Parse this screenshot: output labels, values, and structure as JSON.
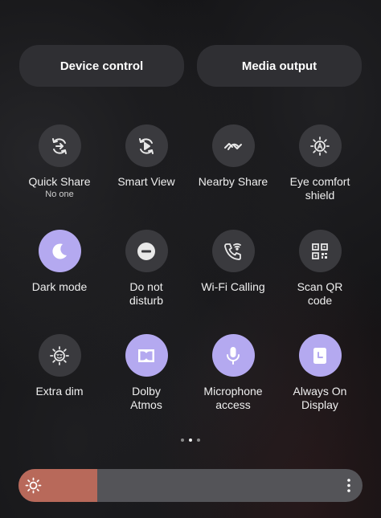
{
  "top_buttons": {
    "device_control": "Device control",
    "media_output": "Media output"
  },
  "tiles": [
    {
      "label": "Quick Share",
      "sub": "No one",
      "icon": "quick-share-icon",
      "on": false
    },
    {
      "label": "Smart View",
      "icon": "smart-view-icon",
      "on": false
    },
    {
      "label": "Nearby Share",
      "icon": "nearby-share-icon",
      "on": false
    },
    {
      "label": "Eye comfort\nshield",
      "icon": "eye-comfort-icon",
      "on": false
    },
    {
      "label": "Dark mode",
      "icon": "moon-icon",
      "on": true
    },
    {
      "label": "Do not\ndisturb",
      "icon": "do-not-disturb-icon",
      "on": false
    },
    {
      "label": "Wi-Fi Calling",
      "icon": "wifi-calling-icon",
      "on": false
    },
    {
      "label": "Scan QR\ncode",
      "icon": "qr-code-icon",
      "on": false
    },
    {
      "label": "Extra dim",
      "icon": "extra-dim-icon",
      "on": false
    },
    {
      "label": "Dolby\nAtmos",
      "icon": "dolby-icon",
      "on": true
    },
    {
      "label": "Microphone\naccess",
      "icon": "microphone-icon",
      "on": true
    },
    {
      "label": "Always On\nDisplay",
      "icon": "clock-icon",
      "on": true
    }
  ],
  "pager": {
    "count": 3,
    "active": 1
  },
  "brightness": {
    "level": 0.23,
    "icon": "sun-icon",
    "menu_icon": "more-vertical-icon"
  },
  "colors": {
    "accent": "#b4a9f0",
    "tile_off": "#3a3a3e",
    "brightness_fill": "#b8695a"
  }
}
